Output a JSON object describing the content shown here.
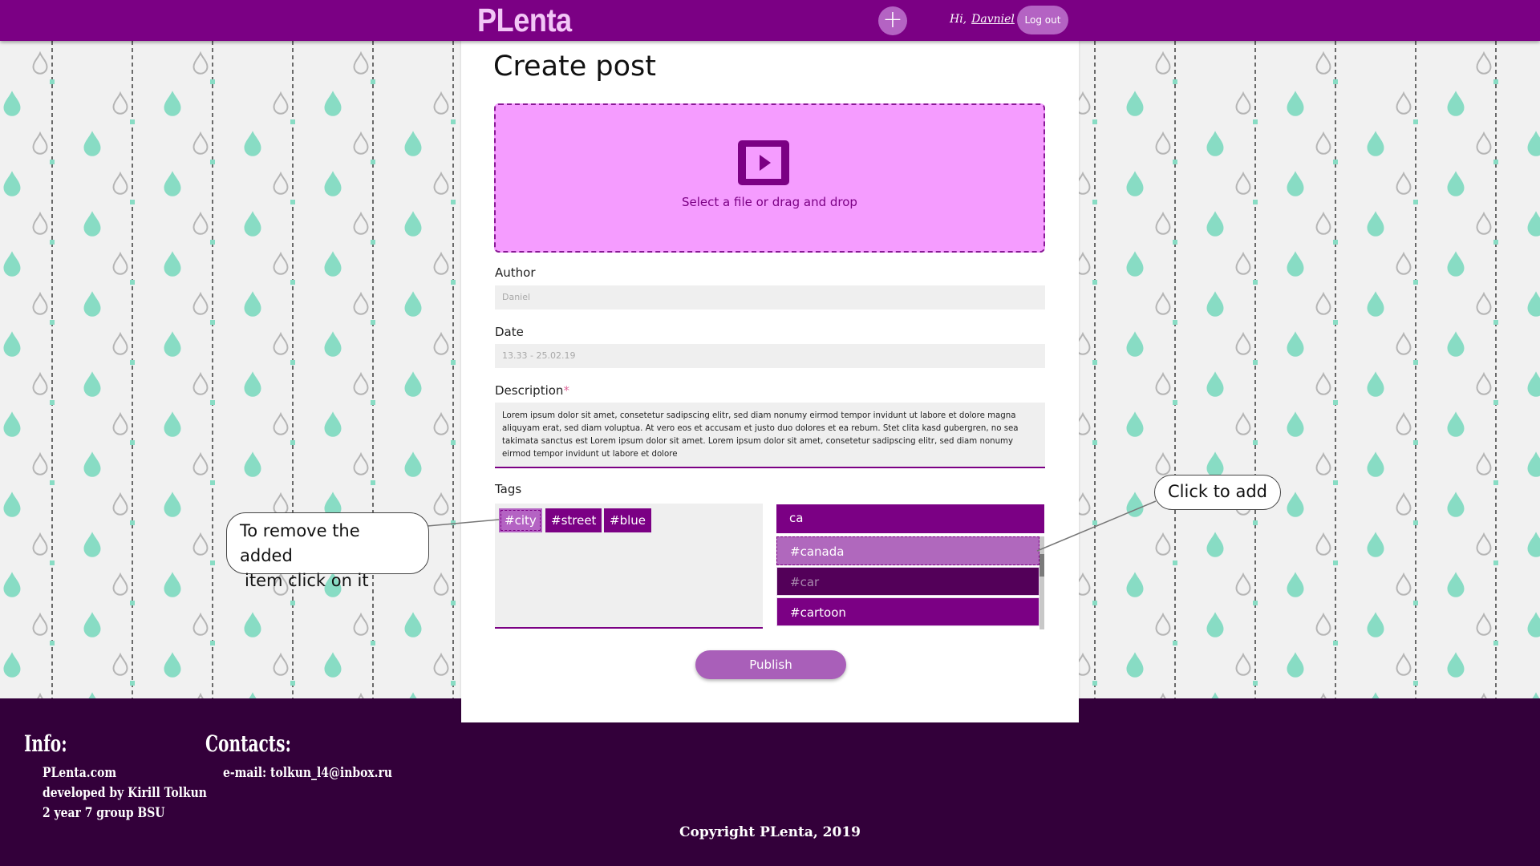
{
  "header": {
    "logo": "PLenta",
    "add_symbol": "+",
    "greeting_prefix": "Hi,",
    "username": "Davniel",
    "logout_label": "Log out"
  },
  "page": {
    "title": "Create post"
  },
  "dropzone": {
    "text": "Select a file or drag and drop"
  },
  "form": {
    "author_label": "Author",
    "author_value": "Daniel",
    "date_label": "Date",
    "date_value": "13.33 - 25.02.19",
    "description_label": "Description",
    "description_required": "*",
    "description_value": "Lorem ipsum dolor sit amet, consetetur sadipscing elitr, sed diam nonumy eirmod tempor invidunt ut labore et dolore magna aliquyam erat, sed diam voluptua. At vero eos et accusam et justo duo dolores et ea rebum. Stet clita kasd gubergren, no sea takimata sanctus est Lorem ipsum dolor sit amet. Lorem ipsum dolor sit amet, consetetur sadipscing elitr, sed diam nonumy eirmod tempor invidunt ut labore et dolore",
    "tags_label": "Tags",
    "tags": [
      "#city",
      "#street",
      "#blue"
    ],
    "tag_search_value": "ca",
    "suggestions": [
      "#canada",
      "#car",
      "#cartoon"
    ],
    "publish_label": "Publish"
  },
  "callouts": {
    "remove_hint_line1": "To remove the added",
    "remove_hint_line2": "item click on it",
    "add_hint": "Click to add"
  },
  "footer": {
    "info_title": "Info:",
    "info_lines": [
      "PLenta.com",
      "developed by Kirill Tolkun",
      "2 year 7 group BSU"
    ],
    "contacts_title": "Contacts:",
    "email": "e-mail: tolkun_l4@inbox.ru",
    "copyright": "Copyright PLenta, 2019"
  },
  "colors": {
    "primary": "#7b0084",
    "accent": "#b463c3",
    "dropzone": "#f59cff",
    "footer": "#33003a",
    "drop_fill": "#88dcc4",
    "drop_outline": "#b5b5b5"
  },
  "icons": {
    "add": "plus-icon",
    "upload": "play-video-icon"
  }
}
